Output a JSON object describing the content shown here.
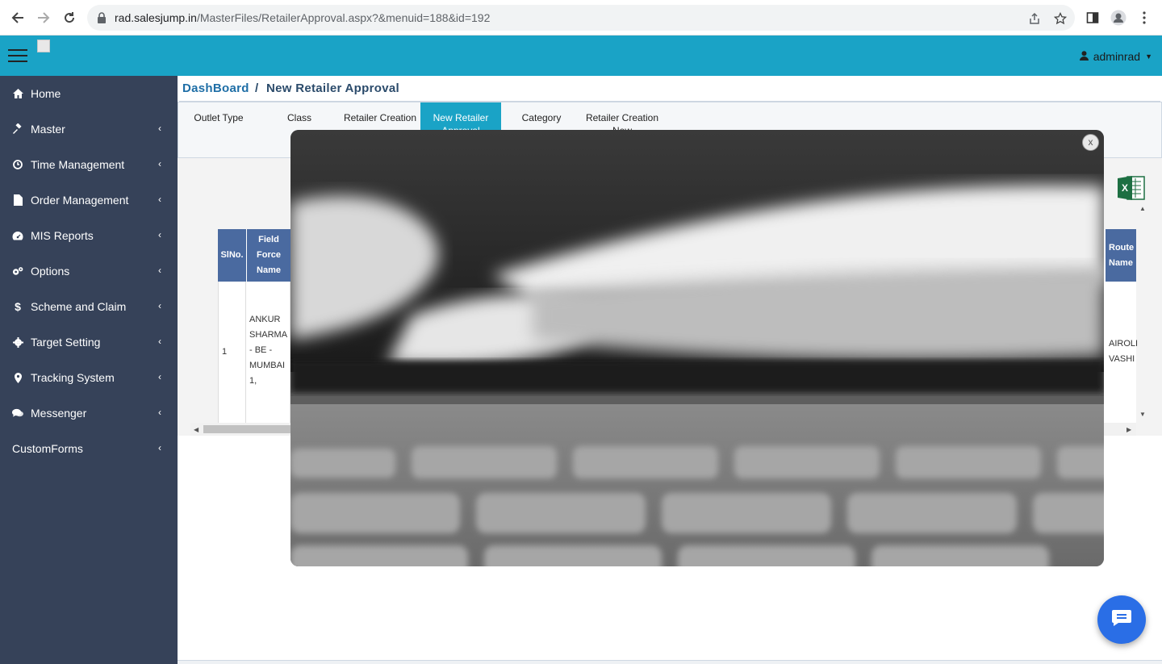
{
  "browser": {
    "url_domain": "rad.salesjump.in",
    "url_path": "/MasterFiles/RetailerApproval.aspx?&menuid=188&id=192"
  },
  "header": {
    "user": "adminrad"
  },
  "sidebar": {
    "items": [
      {
        "label": "Home",
        "icon": "home-icon",
        "has_submenu": false
      },
      {
        "label": "Master",
        "icon": "gavel-icon",
        "has_submenu": true
      },
      {
        "label": "Time Management",
        "icon": "clock-icon",
        "has_submenu": true
      },
      {
        "label": "Order Management",
        "icon": "file-icon",
        "has_submenu": true
      },
      {
        "label": "MIS Reports",
        "icon": "dashboard-icon",
        "has_submenu": true
      },
      {
        "label": "Options",
        "icon": "cogs-icon",
        "has_submenu": true
      },
      {
        "label": "Scheme and Claim",
        "icon": "dollar-icon",
        "has_submenu": true
      },
      {
        "label": "Target Setting",
        "icon": "gear-icon",
        "has_submenu": true
      },
      {
        "label": "Tracking System",
        "icon": "map-marker-icon",
        "has_submenu": true
      },
      {
        "label": "Messenger",
        "icon": "comments-icon",
        "has_submenu": true
      },
      {
        "label": "CustomForms",
        "icon": "",
        "has_submenu": true
      }
    ]
  },
  "breadcrumb": {
    "root": "DashBoard",
    "separator": "/",
    "current": "New Retailer Approval"
  },
  "tabs": [
    {
      "label": "Outlet Type",
      "active": false
    },
    {
      "label": "Class",
      "active": false
    },
    {
      "label": "Retailer Creation",
      "active": false
    },
    {
      "label": "New Retailer Approval",
      "active": true
    },
    {
      "label": "Category",
      "active": false
    },
    {
      "label": "Retailer Creation New",
      "active": false
    }
  ],
  "table": {
    "headers": {
      "slno": "SlNo.",
      "field_force_name": "Field Force Name",
      "route_name": "Route Name"
    },
    "rows": [
      {
        "slno": "1",
        "field_force_name": "ANKUR SHARMA - BE - MUMBAI 1,",
        "route_name": "AIROLI VASHI"
      }
    ]
  },
  "lightbox": {
    "close_label": "x"
  },
  "colors": {
    "header_bg": "#1aa3c6",
    "sidebar_bg": "#364259",
    "table_header": "#4a6aa0",
    "chat_button": "#2a6ee6"
  }
}
